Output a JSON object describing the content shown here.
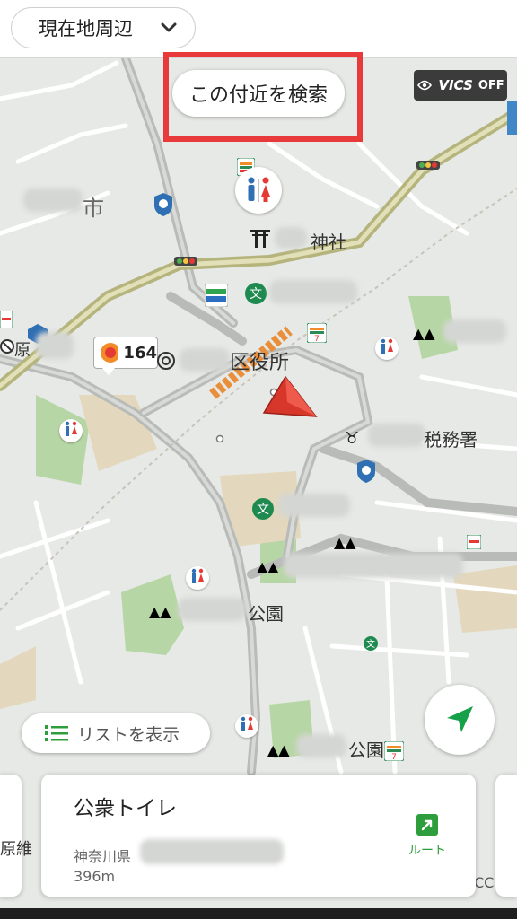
{
  "header": {
    "area_selector_label": "現在地周辺"
  },
  "map": {
    "search_nearby_label": "この付近を検索",
    "vics_label": "VICS",
    "vics_state": "OFF",
    "labels": {
      "city_suffix": "市",
      "shrine": "神社",
      "ward_office": "区役所",
      "tax_office": "税務署",
      "park_1": "公園",
      "park_2": "公園",
      "left_edge_1": "原",
      "left_edge_2": "原維",
      "right_edge": "CC"
    },
    "gas_price": "164",
    "colors": {
      "main_road": "#b5b47d",
      "road": "#b9bbb8",
      "green_area": "#b7d6a5",
      "sand_area": "#e3d8bd",
      "highlight": "#e8393b",
      "location_arrow": "#d6372a"
    }
  },
  "list_button": {
    "label": "リストを表示"
  },
  "locate_button": {
    "icon": "navigation-arrow-icon"
  },
  "card": {
    "title": "公衆トイレ",
    "address": "神奈川県",
    "distance": "396m",
    "route_label": "ルート"
  }
}
